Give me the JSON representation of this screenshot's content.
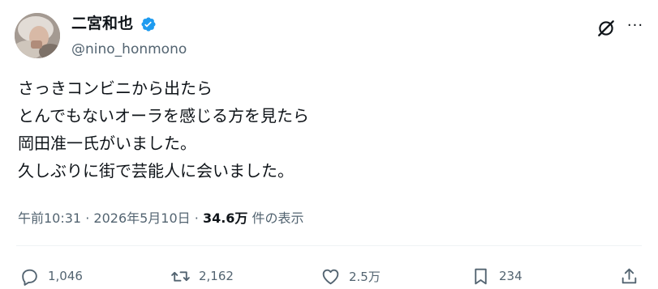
{
  "user": {
    "display_name": "二宮和也",
    "handle": "@nino_honmono",
    "verified_icon": "verified-badge-icon"
  },
  "header_icons": {
    "grok": "grok-icon",
    "more": "more-options-icon"
  },
  "tweet": {
    "lines": [
      "さっきコンビニから出たら",
      "とんでもないオーラを感じる方を見たら",
      "岡田准一氏がいました。",
      "久しぶりに街で芸能人に会いました。"
    ]
  },
  "meta": {
    "time": "午前10:31",
    "separator": "·",
    "date": "2026年5月10日",
    "views_count": "34.6万",
    "views_label": "件の表示"
  },
  "actions": {
    "replies": "1,046",
    "reposts": "2,162",
    "likes": "2.5万",
    "bookmarks": "234"
  },
  "colors": {
    "text": "#0f1419",
    "secondary": "#536471",
    "verified": "#1d9bf0"
  }
}
